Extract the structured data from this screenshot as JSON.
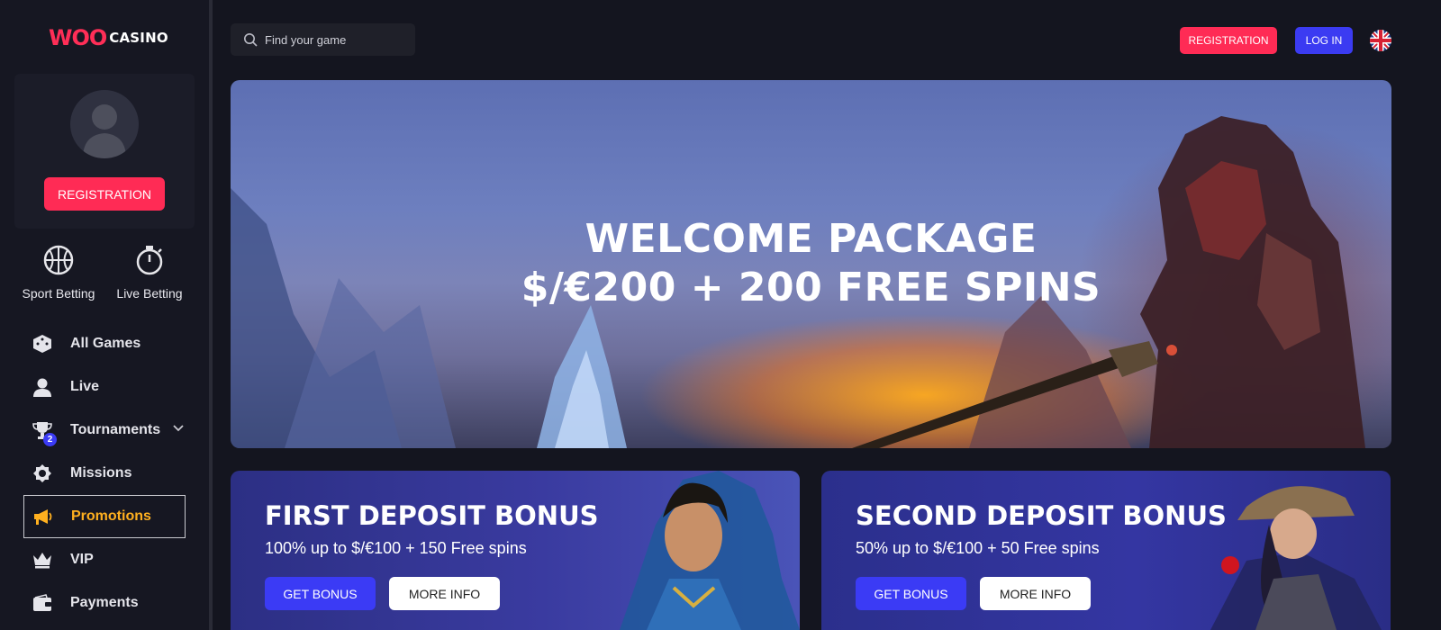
{
  "logo": {
    "woo": "WOO",
    "casino": "CASINO"
  },
  "sidebar": {
    "registration_label": "REGISTRATION",
    "betting": [
      {
        "label": "Sport Betting",
        "icon": "basketball-icon"
      },
      {
        "label": "Live Betting",
        "icon": "stopwatch-icon"
      }
    ],
    "nav": [
      {
        "label": "All Games",
        "icon": "dice-icon"
      },
      {
        "label": "Live",
        "icon": "dealer-icon"
      },
      {
        "label": "Tournaments",
        "icon": "trophy-icon",
        "badge": "2"
      },
      {
        "label": "Missions",
        "icon": "medal-icon"
      },
      {
        "label": "Promotions",
        "icon": "megaphone-icon",
        "active": true
      },
      {
        "label": "VIP",
        "icon": "crown-icon"
      },
      {
        "label": "Payments",
        "icon": "wallet-icon"
      }
    ]
  },
  "header": {
    "search_placeholder": "Find your game",
    "registration_label": "REGISTRATION",
    "login_label": "LOG IN",
    "language": "uk-flag-icon"
  },
  "hero": {
    "line1": "WELCOME PACKAGE",
    "line2": "$/€200 + 200 FREE SPINS"
  },
  "bonuses": [
    {
      "title": "FIRST DEPOSIT BONUS",
      "subtitle": "100% up to $/€100 + 150 Free spins",
      "get_label": "GET BONUS",
      "more_label": "MORE INFO"
    },
    {
      "title": "SECOND DEPOSIT BONUS",
      "subtitle": "50% up to $/€100 + 50 Free spins",
      "get_label": "GET BONUS",
      "more_label": "MORE INFO"
    }
  ],
  "colors": {
    "accent_red": "#ff2b55",
    "accent_blue": "#3b3bf5",
    "active_nav": "#ffb01f",
    "background": "#14151f"
  }
}
